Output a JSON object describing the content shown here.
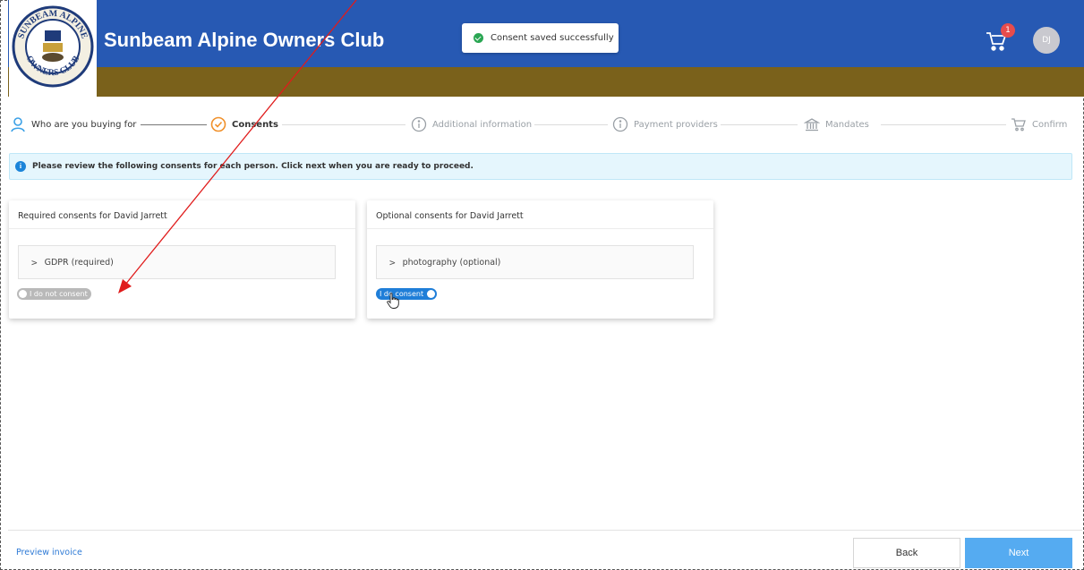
{
  "header": {
    "club_title": "Sunbeam Alpine Owners Club",
    "toast_message": "Consent saved successfully",
    "cart_count": "1",
    "avatar_initials": "DJ",
    "logo_text_top": "SUNBEAM ALPINE",
    "logo_text_bottom": "OWNERS CLUB",
    "colors": {
      "header": "#2759b3",
      "subbar": "#7a611b"
    }
  },
  "steps": [
    {
      "label": "Who are you buying for",
      "state": "done",
      "icon": "user-icon"
    },
    {
      "label": "Consents",
      "state": "active",
      "icon": "check-circle-icon"
    },
    {
      "label": "Additional information",
      "state": "pending",
      "icon": "info-circle-icon"
    },
    {
      "label": "Payment providers",
      "state": "pending",
      "icon": "info-circle-icon"
    },
    {
      "label": "Mandates",
      "state": "pending",
      "icon": "bank-icon"
    },
    {
      "label": "Confirm",
      "state": "pending",
      "icon": "cart-icon"
    }
  ],
  "info_banner": "Please review the following consents for each person. Click next when you are ready to proceed.",
  "required_card": {
    "title": "Required consents for David Jarrett",
    "item_label": "GDPR (required)",
    "toggle_label": "I do not consent",
    "toggle_on": false
  },
  "optional_card": {
    "title": "Optional consents for David Jarrett",
    "item_label": "photography (optional)",
    "toggle_label": "I do consent",
    "toggle_on": true
  },
  "footer": {
    "preview_link": "Preview invoice",
    "back_label": "Back",
    "next_label": "Next"
  }
}
